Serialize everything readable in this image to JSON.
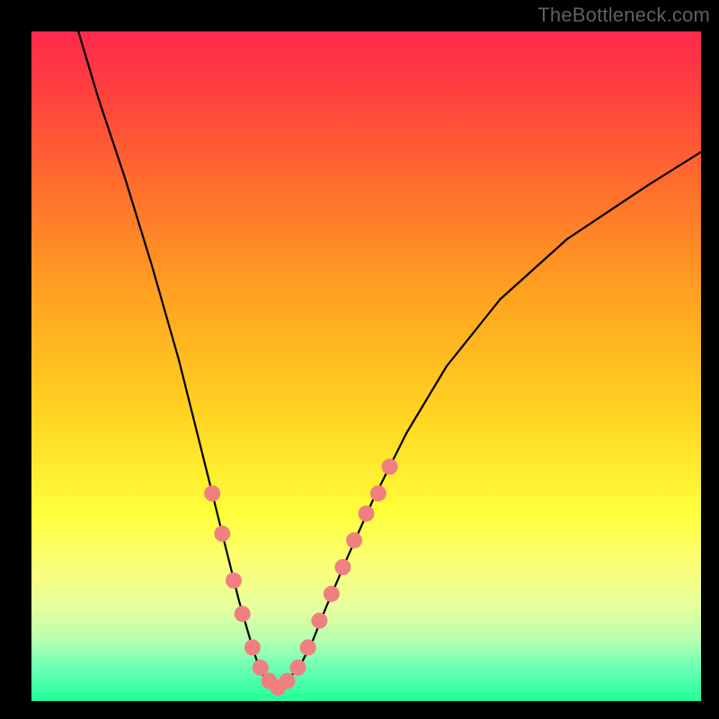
{
  "watermark": "TheBottleneck.com",
  "chart_data": {
    "type": "line",
    "title": "",
    "xlabel": "",
    "ylabel": "",
    "xlim": [
      0,
      100
    ],
    "ylim": [
      0,
      100
    ],
    "series": [
      {
        "name": "bottleneck-curve",
        "x": [
          7,
          10,
          14,
          18,
          22,
          25,
          27,
          29,
          31,
          33,
          34,
          35,
          36,
          37,
          38,
          40,
          42,
          44,
          47,
          51,
          56,
          62,
          70,
          80,
          92,
          100
        ],
        "y": [
          100,
          90,
          78,
          65,
          51,
          39,
          31,
          23,
          15,
          8,
          5,
          3,
          2,
          2,
          3,
          5,
          9,
          14,
          21,
          30,
          40,
          50,
          60,
          69,
          77,
          82
        ]
      }
    ],
    "markers": {
      "name": "highlight-beads",
      "color": "#f08080",
      "points": [
        {
          "x": 27.0,
          "y": 31
        },
        {
          "x": 28.5,
          "y": 25
        },
        {
          "x": 30.2,
          "y": 18
        },
        {
          "x": 31.5,
          "y": 13
        },
        {
          "x": 33.0,
          "y": 8
        },
        {
          "x": 34.2,
          "y": 5
        },
        {
          "x": 35.5,
          "y": 3
        },
        {
          "x": 36.8,
          "y": 2
        },
        {
          "x": 38.2,
          "y": 3
        },
        {
          "x": 39.8,
          "y": 5
        },
        {
          "x": 41.3,
          "y": 8
        },
        {
          "x": 43.0,
          "y": 12
        },
        {
          "x": 44.8,
          "y": 16
        },
        {
          "x": 46.5,
          "y": 20
        },
        {
          "x": 48.2,
          "y": 24
        },
        {
          "x": 50.0,
          "y": 28
        },
        {
          "x": 51.8,
          "y": 31
        },
        {
          "x": 53.5,
          "y": 35
        }
      ]
    },
    "gradient_stops": [
      {
        "pos": 0,
        "color": "#ff2a4d"
      },
      {
        "pos": 22,
        "color": "#ff6a2e"
      },
      {
        "pos": 58,
        "color": "#ffd621"
      },
      {
        "pos": 80,
        "color": "#faff7a"
      },
      {
        "pos": 100,
        "color": "#20ff9a"
      }
    ]
  }
}
